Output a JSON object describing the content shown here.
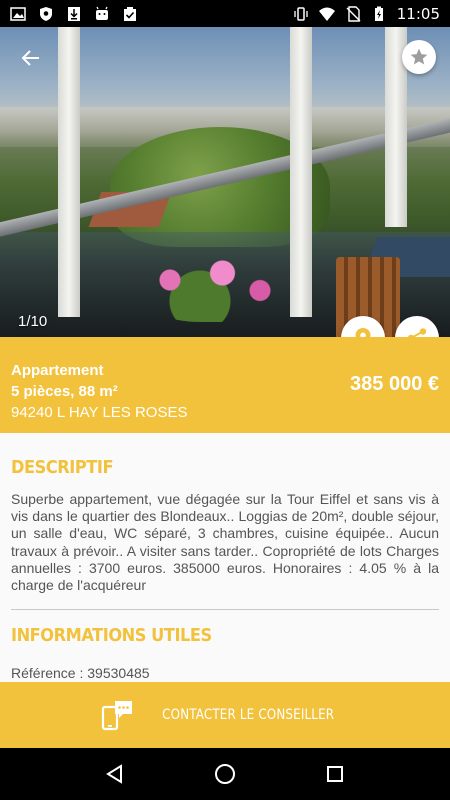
{
  "status_bar": {
    "time": "11:05",
    "left_icons": [
      "image-icon",
      "shield-icon",
      "download-icon",
      "android-icon",
      "clipboard-check-icon"
    ],
    "right_icons": [
      "vibrate-icon",
      "wifi-icon",
      "no-sim-icon",
      "battery-charging-icon"
    ]
  },
  "gallery": {
    "counter": "1/10"
  },
  "listing": {
    "type": "Appartement",
    "rooms_area": "5 pièces, 88 m²",
    "location": "94240 L HAY LES ROSES",
    "price": "385 000 €"
  },
  "sections": {
    "description_title": "DESCRIPTIF",
    "description_text": "Superbe appartement, vue dégagée sur la Tour Eiffel et sans vis à vis dans le quartier des Blondeaux.. Loggias de 20m², double séjour, un salle d'eau, WC séparé, 3 chambres, cuisine équipée.. Aucun travaux à prévoir.. A visiter sans tarder.. Copropriété de lots Charges annuelles : 3700 euros. 385000 euros. Honoraires : 4.05 % à la charge de l'acquéreur",
    "info_title": "INFORMATIONS UTILES",
    "reference": "Référence : 39530485"
  },
  "contact": {
    "label": "CONTACTER LE CONSEILLER"
  },
  "colors": {
    "accent": "#f2c23c",
    "text": "#555555",
    "white": "#ffffff"
  }
}
